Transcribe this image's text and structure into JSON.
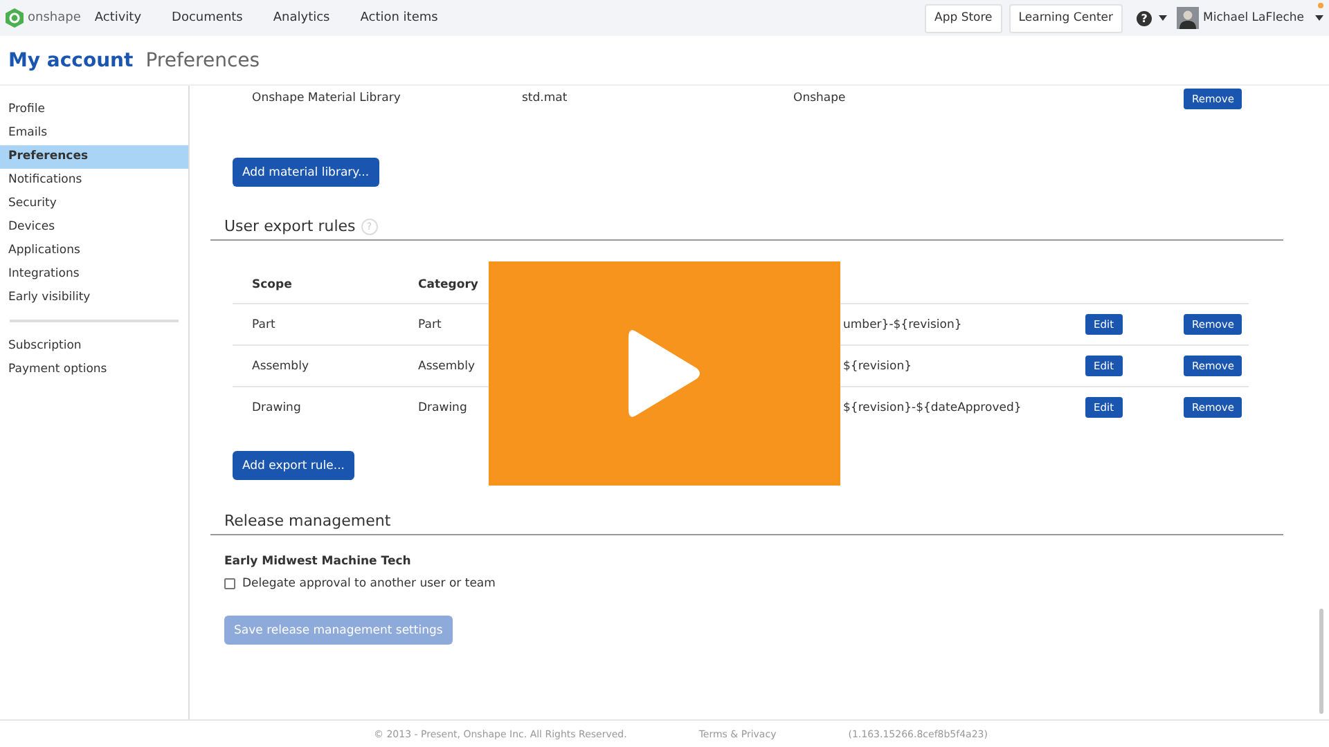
{
  "nav": {
    "logo": "onshape",
    "items": [
      "Activity",
      "Documents",
      "Analytics",
      "Action items"
    ],
    "buttons": [
      "App Store",
      "Learning Center"
    ],
    "help": "?",
    "user": "Michael LaFleche",
    "notification": true
  },
  "page_header": {
    "title": "My account",
    "subtitle": "Preferences"
  },
  "sidebar": {
    "groups": [
      [
        {
          "label": "Profile",
          "selected": false
        },
        {
          "label": "Emails",
          "selected": false
        },
        {
          "label": "Preferences",
          "selected": true
        },
        {
          "label": "Notifications",
          "selected": false
        },
        {
          "label": "Security",
          "selected": false
        },
        {
          "label": "Devices",
          "selected": false
        },
        {
          "label": "Applications",
          "selected": false
        },
        {
          "label": "Integrations",
          "selected": false
        },
        {
          "label": "Early visibility",
          "selected": false
        }
      ],
      [
        {
          "label": "Subscription",
          "selected": false
        },
        {
          "label": "Payment options",
          "selected": false
        }
      ]
    ]
  },
  "material_libraries": {
    "rows": [
      {
        "name": "Onshape Material Library",
        "file": "std.mat",
        "owner": "Onshape",
        "action": "Remove"
      }
    ],
    "add_button": "Add material library..."
  },
  "export_rules": {
    "title": "User export rules",
    "help": "?",
    "columns": [
      "Scope",
      "Category"
    ],
    "rows": [
      {
        "scope": "Part",
        "category": "Part",
        "column_4": "umber}-${revision}",
        "edit": "Edit",
        "remove": "Remove"
      },
      {
        "scope": "Assembly",
        "category": "Assembly",
        "column_4": "${revision}",
        "edit": "Edit",
        "remove": "Remove"
      },
      {
        "scope": "Drawing",
        "category": "Drawing",
        "column_4": "${revision}-${dateApproved}",
        "edit": "Edit",
        "remove": "Remove"
      }
    ],
    "add_button": "Add export rule..."
  },
  "release_management": {
    "title": "Release management",
    "company": "Early Midwest Machine Tech",
    "delegate": {
      "label": "Delegate approval to another user or team",
      "checked": false
    },
    "save_button": {
      "label": "Save release management settings",
      "disabled": true
    }
  },
  "footer": [
    "© 2013 - Present, Onshape Inc. All Rights Reserved.",
    "Terms & Privacy",
    "(1.163.15266.8cef8b5f4a23)"
  ]
}
